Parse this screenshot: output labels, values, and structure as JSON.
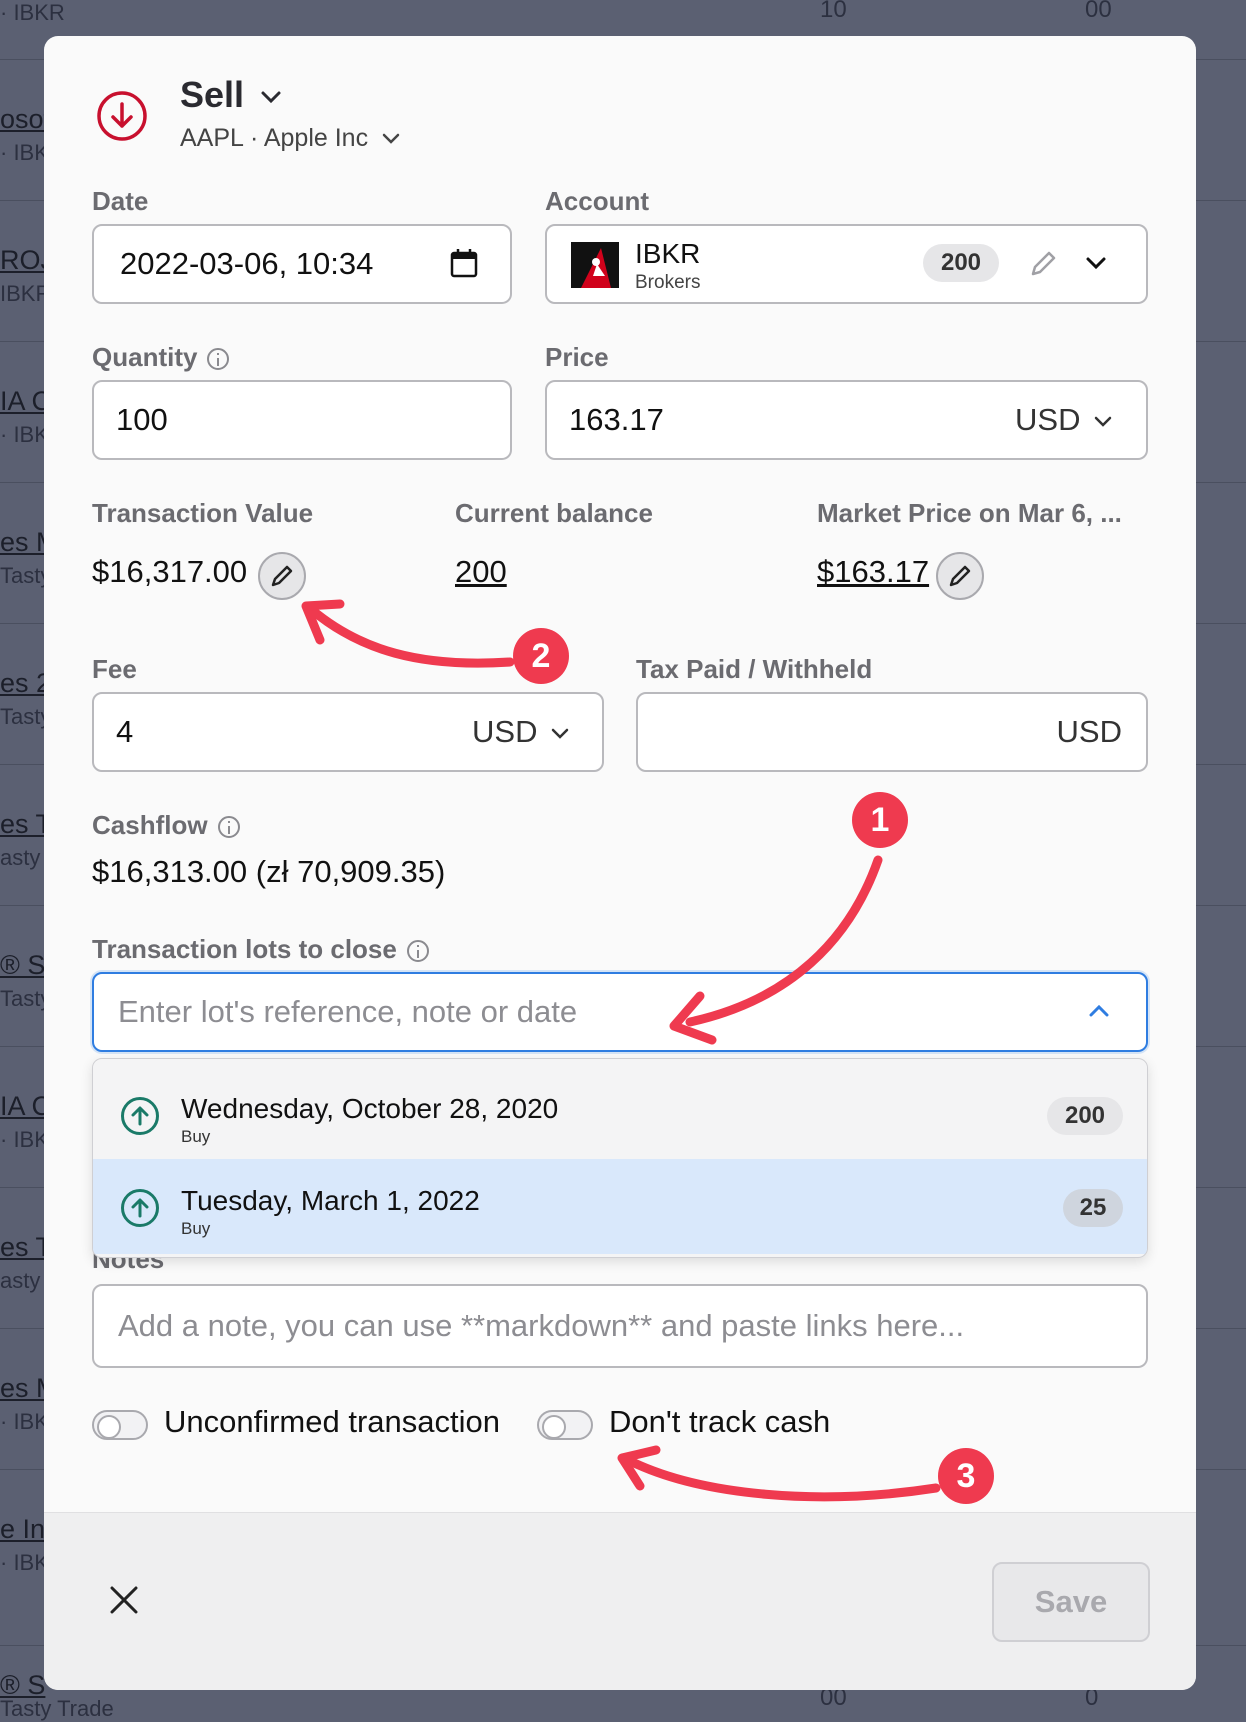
{
  "background": {
    "rows": [
      {
        "name": "",
        "sub": "· IBKR",
        "num1": "10",
        "num2": "00"
      },
      {
        "name": "osoft",
        "sub": "· IBKR"
      },
      {
        "name": "ROJ",
        "sub": "IBKR"
      },
      {
        "name": "IA C",
        "sub": "· IBKR"
      },
      {
        "name": "es M",
        "sub": "Tasty"
      },
      {
        "name": "es 2",
        "sub": "Tasty"
      },
      {
        "name": "es T",
        "sub": "asty"
      },
      {
        "name": "® S",
        "sub": "Tasty"
      },
      {
        "name": "IA C",
        "sub": "· IBKR"
      },
      {
        "name": "es T",
        "sub": "asty"
      },
      {
        "name": "es M",
        "sub": "· IBKR"
      },
      {
        "name": "e Inc",
        "sub": "· IBKR"
      },
      {
        "name": "® S",
        "sub": "Tasty Trade",
        "num1": "00",
        "num2": "0"
      }
    ]
  },
  "header": {
    "action": "Sell",
    "asset": "AAPL · Apple Inc"
  },
  "form": {
    "date_label": "Date",
    "date_value": "2022-03-06, 10:34",
    "account_label": "Account",
    "account_name": "IBKR",
    "account_type": "Brokers",
    "account_badge": "200",
    "quantity_label": "Quantity",
    "quantity_value": "100",
    "price_label": "Price",
    "price_value": "163.17",
    "price_currency": "USD",
    "txn_value_label": "Transaction Value",
    "txn_value": "$16,317.00",
    "balance_label": "Current balance",
    "balance_value": "200",
    "market_price_label": "Market Price on Mar 6, ...",
    "market_price_value": "$163.17",
    "fee_label": "Fee",
    "fee_value": "4",
    "fee_currency": "USD",
    "tax_label": "Tax Paid / Withheld",
    "tax_currency": "USD",
    "cashflow_label": "Cashflow",
    "cashflow_value": "$16,313.00 (zł 70,909.35)",
    "lots_label": "Transaction lots to close",
    "lots_placeholder": "Enter lot's reference, note or date",
    "notes_label": "Notes",
    "notes_placeholder": "Add a note, you can use **markdown** and paste links here...",
    "unconfirmed_label": "Unconfirmed transaction",
    "dont_track_label": "Don't track cash"
  },
  "lots": [
    {
      "date": "Wednesday, October 28, 2020",
      "type": "Buy",
      "qty": "200"
    },
    {
      "date": "Tuesday, March 1, 2022",
      "type": "Buy",
      "qty": "25"
    }
  ],
  "footer": {
    "save_label": "Save"
  },
  "annotations": [
    "1",
    "2",
    "3"
  ],
  "colors": {
    "sell_red": "#c8102e",
    "buy_green": "#1a7a68",
    "focus_blue": "#2f7de1",
    "callout_red": "#ef3a4f"
  }
}
